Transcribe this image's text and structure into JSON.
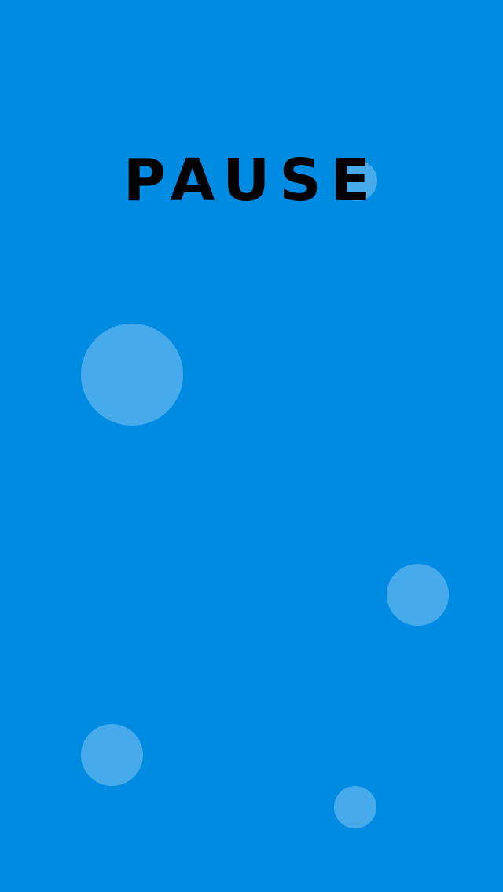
{
  "screen": {
    "title": "PAUSE",
    "background_color": "#008be3",
    "bubble_color": "rgba(255,255,255,0.28)"
  }
}
